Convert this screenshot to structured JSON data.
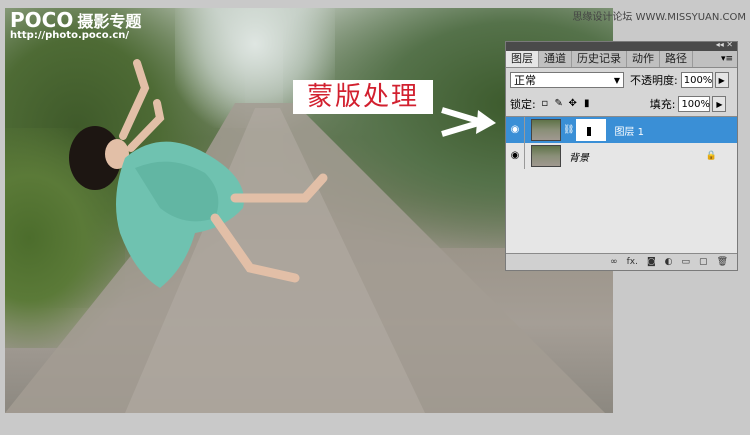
{
  "logo": {
    "brand": "POCO",
    "sub": "摄影专题",
    "url": "http://photo.poco.cn/"
  },
  "watermark": "思缘设计论坛 WWW.MISSYUAN.COM",
  "caption": "蒙版处理",
  "panel": {
    "tabs": [
      "图层",
      "通道",
      "历史记录",
      "动作",
      "路径"
    ],
    "active_tab": "图层",
    "blend_mode": "正常",
    "opacity_label": "不透明度:",
    "opacity_value": "100%",
    "lock_label": "锁定:",
    "fill_label": "填充:",
    "fill_value": "100%",
    "layers": [
      {
        "name": "图层 1",
        "selected": true
      },
      {
        "name": "背景",
        "selected": false
      }
    ],
    "bottom_icons": [
      "link-icon",
      "fx-icon",
      "mask-icon",
      "adjustment-icon",
      "folder-icon",
      "new-layer-icon",
      "trash-icon"
    ]
  },
  "colors": {
    "caption_text": "#d2202f",
    "selection": "#3a8fd6"
  }
}
